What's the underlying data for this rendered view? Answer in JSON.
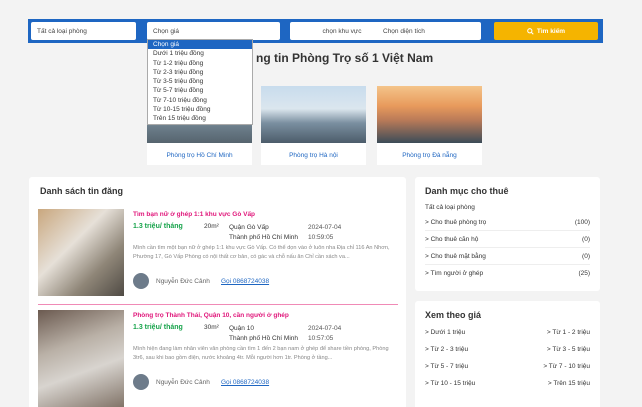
{
  "search": {
    "room_type": "Tất cả loại phòng",
    "price": "Chọn giá",
    "area_region": "chọn khu vực",
    "size": "Chọn diện tích",
    "button": "Tìm kiếm"
  },
  "price_dropdown": {
    "options": [
      "Chọn giá",
      "Dưới 1 triệu đồng",
      "Từ 1-2 triệu đồng",
      "Từ 2-3 triệu đồng",
      "Từ 3-5 triệu đồng",
      "Từ 5-7 triệu đồng",
      "Từ 7-10 triệu đồng",
      "Từ 10-15 triệu đồng",
      "Trên 15 triệu đồng"
    ]
  },
  "headline": "ng tin Phòng Trọ số 1 Việt Nam",
  "cities": [
    "Phòng trọ Hồ Chí Minh",
    "Phòng trọ Hà nội",
    "Phòng trọ Đà nẵng"
  ],
  "listing": {
    "title": "Danh sách tin đăng",
    "posts": [
      {
        "title": "Tìm bạn nữ ở ghép 1:1 khu vực Gò Vấp",
        "price": "1.3 triệu/ tháng",
        "area": "20m²",
        "loc1": "Quận Gò Vấp",
        "loc2": "Thành phố Hồ Chí Minh",
        "date": "2024-07-04",
        "time": "10:59:05",
        "desc": "Mình cần tìm một bạn nữ ở ghép 1:1 khu vực Gò Vấp. Có thể dọn vào ở luôn nha Địa chỉ 116 An Nhơn, Phường 17, Gò Vấp Phòng có nội thất cơ bản, có gác và chỗ nấu ăn Chỉ cần xách va...",
        "author": "Nguyễn Đức Cảnh",
        "phone": "Gọi 0868724038"
      },
      {
        "title": "Phòng trọ Thành Thái, Quận 10, cần người ở ghép",
        "price": "1.3 triệu/ tháng",
        "area": "30m²",
        "loc1": "Quận 10",
        "loc2": "Thành phố Hồ Chí Minh",
        "date": "2024-07-04",
        "time": "10:57:05",
        "desc": "Mình hiện đang làm nhân viên văn phòng cần tìm 1 đến 2 bạn nam ở ghép để share tiền phòng, Phòng 3tr6, sau khi bao gồm điện, nước khoảng 4tr. Mỗi người hơn 1tr. Phòng ở tầng...",
        "author": "Nguyễn Đức Cảnh",
        "phone": "Gọi 0868724038"
      }
    ]
  },
  "categories": {
    "title": "Danh mục cho thuê",
    "all": "Tất cả loại phòng",
    "items": [
      {
        "label": "> Cho thuê phòng trọ",
        "count": "(100)"
      },
      {
        "label": "> Cho thuê căn hộ",
        "count": "(0)"
      },
      {
        "label": "> Cho thuê mặt bằng",
        "count": "(0)"
      },
      {
        "label": "> Tìm người ở ghép",
        "count": "(25)"
      }
    ]
  },
  "price_view": {
    "title": "Xem theo giá",
    "rows": [
      {
        "left": "> Dưới 1 triệu",
        "right": "> Từ 1 - 2 triệu"
      },
      {
        "left": "> Từ 2 - 3 triệu",
        "right": "> Từ 3 - 5 triệu"
      },
      {
        "left": "> Từ 5 - 7 triệu",
        "right": "> Từ 7 - 10 triệu"
      },
      {
        "left": "> Từ 10 - 15 triệu",
        "right": "> Trên 15 triệu"
      }
    ]
  }
}
